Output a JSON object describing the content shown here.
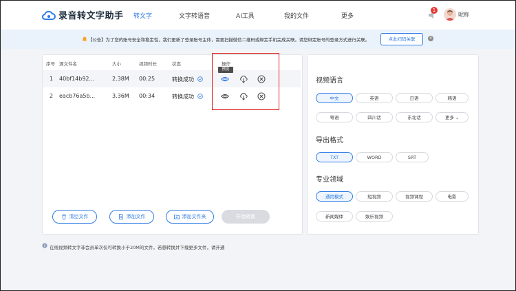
{
  "header": {
    "app_name": "录音转文字助手",
    "nav": [
      "转文字",
      "文字转语音",
      "AI工具",
      "我的文件",
      "更多"
    ],
    "notification_count": "1",
    "nickname": "昵称"
  },
  "notice": {
    "text": "【公告】为了您的账号安全和稳定性，我们更新了登录账号主体，需要扫描微信二维码或绑定手机完成关联。请您绑定账号的登录方式进行关联。",
    "button": "点此扫码关联"
  },
  "table": {
    "headers": [
      "序号",
      "源文件名",
      "大小",
      "视频时长",
      "状态",
      "操作"
    ],
    "rows": [
      {
        "index": "1",
        "name": "40bf14b92...",
        "size": "2.38M",
        "duration": "00:25",
        "status": "转换成功"
      },
      {
        "index": "2",
        "name": "eacb76a5b...",
        "size": "3.36M",
        "duration": "00:34",
        "status": "转换成功"
      }
    ],
    "tooltip": "预览"
  },
  "actions": {
    "clear": "清空文件",
    "add_file": "添加文件",
    "add_folder": "添加文件夹",
    "start": "开始转换"
  },
  "footer_note": "在线视频转文字非会员单次仅可转换小于20M的文件，若想转换并下载更多文件，请开通",
  "settings": {
    "language_title": "视频语言",
    "languages": [
      "中文",
      "英语",
      "日语",
      "韩语",
      "粤语",
      "四川话",
      "东北话",
      "更多"
    ],
    "format_title": "导出格式",
    "formats": [
      "TXT",
      "WORD",
      "SRT"
    ],
    "domain_title": "专业领域",
    "domains": [
      "通用模式",
      "短视频",
      "视频课程",
      "电影",
      "新闻媒体",
      "娱乐视频"
    ]
  },
  "colors": {
    "accent": "#2f7be5",
    "highlight_box": "#e02020",
    "badge": "#e53935"
  }
}
